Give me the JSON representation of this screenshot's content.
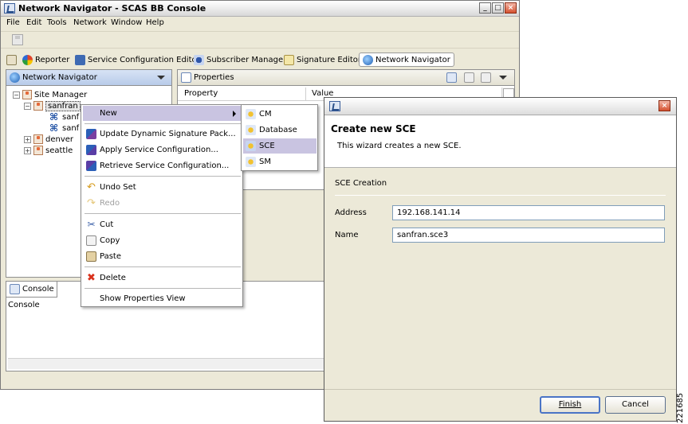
{
  "window": {
    "title": "Network Navigator - SCAS BB Console",
    "controls": {
      "minimize": "_",
      "maximize": "□",
      "close": "×"
    }
  },
  "menubar": [
    "File",
    "Edit",
    "Tools",
    "Network",
    "Window",
    "Help"
  ],
  "perspectives": [
    {
      "label": "Reporter",
      "icon": "reporter-icon",
      "active": false
    },
    {
      "label": "Service Configuration Editor",
      "icon": "service-config-icon",
      "active": false
    },
    {
      "label": "Subscriber Manager",
      "icon": "subscriber-manager-icon",
      "active": false
    },
    {
      "label": "Signature Editor",
      "icon": "signature-editor-icon",
      "active": false
    },
    {
      "label": "Network Navigator",
      "icon": "network-navigator-icon",
      "active": true
    }
  ],
  "navigator": {
    "title": "Network Navigator",
    "tree": {
      "root": "Site Manager",
      "sites": [
        "sanfran",
        "denver",
        "seattle"
      ],
      "sanfran_children": [
        "sanf",
        "sanf"
      ]
    }
  },
  "properties": {
    "title": "Properties",
    "columns": [
      "Property",
      "Value"
    ]
  },
  "console": {
    "title": "Console",
    "label": "Console"
  },
  "context_menu": {
    "items": [
      {
        "label": "New",
        "icon": "",
        "submenu": true
      },
      {
        "label": "Update Dynamic Signature Pack...",
        "icon": "update-icon"
      },
      {
        "label": "Apply Service Configuration...",
        "icon": "apply-icon"
      },
      {
        "label": "Retrieve Service Configuration...",
        "icon": "retrieve-icon"
      },
      {
        "label": "Undo Set",
        "icon": "undo-icon"
      },
      {
        "label": "Redo",
        "icon": "redo-icon",
        "disabled": true
      },
      {
        "label": "Cut",
        "icon": "cut-icon"
      },
      {
        "label": "Copy",
        "icon": "copy-icon"
      },
      {
        "label": "Paste",
        "icon": "paste-icon"
      },
      {
        "label": "Delete",
        "icon": "delete-icon"
      },
      {
        "label": "Show Properties View",
        "icon": ""
      }
    ],
    "submenu": [
      "CM",
      "Database",
      "SCE",
      "SM"
    ],
    "submenu_selected": "SCE"
  },
  "dialog": {
    "heading": "Create new SCE",
    "description": "This wizard creates a new SCE.",
    "section": "SCE Creation",
    "fields": {
      "address_label": "Address",
      "address_value": "192.168.141.14",
      "name_label": "Name",
      "name_value": "sanfran.sce3"
    },
    "buttons": {
      "finish": "Finish",
      "cancel": "Cancel"
    }
  },
  "figure_id": "221685"
}
